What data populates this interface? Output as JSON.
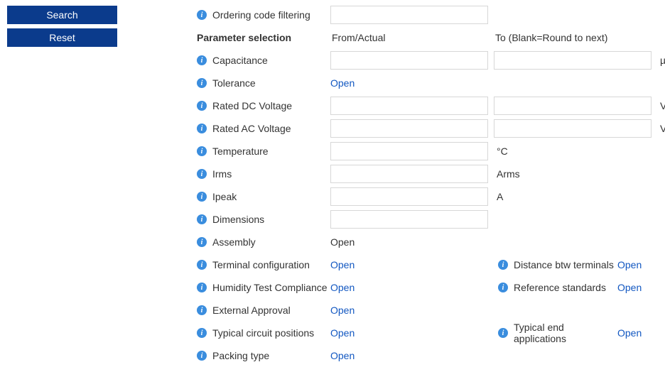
{
  "sidebar": {
    "search_label": "Search",
    "reset_label": "Reset"
  },
  "filter": {
    "ordering_code_label": "Ordering code filtering",
    "ordering_code_value": ""
  },
  "header": {
    "param_selection": "Parameter selection",
    "from_actual": "From/Actual",
    "to_blank": "To (Blank=Round to next)"
  },
  "params": {
    "capacitance": {
      "label": "Capacitance",
      "from": "",
      "to": "",
      "unit": "µF"
    },
    "tolerance": {
      "label": "Tolerance",
      "action": "Open"
    },
    "rated_dc": {
      "label": "Rated DC Voltage",
      "from": "",
      "to": "",
      "unit": "Vdc"
    },
    "rated_ac": {
      "label": "Rated AC Voltage",
      "from": "",
      "to": "",
      "unit": "Vrms"
    },
    "temperature": {
      "label": "Temperature",
      "from": "",
      "unit": "°C"
    },
    "irms": {
      "label": "Irms",
      "from": "",
      "unit": "Arms"
    },
    "ipeak": {
      "label": "Ipeak",
      "from": "",
      "unit": "A"
    },
    "dimensions": {
      "label": "Dimensions",
      "from": ""
    },
    "assembly": {
      "label": "Assembly",
      "action": "Open"
    },
    "terminal_config": {
      "label": "Terminal configuration",
      "action": "Open"
    },
    "distance_terminals": {
      "label": "Distance btw terminals",
      "action": "Open"
    },
    "humidity": {
      "label": "Humidity Test Compliance",
      "action": "Open"
    },
    "reference_standards": {
      "label": "Reference standards",
      "action": "Open"
    },
    "external_approval": {
      "label": "External Approval",
      "action": "Open"
    },
    "typical_circuit": {
      "label": "Typical circuit positions",
      "action": "Open"
    },
    "typical_end": {
      "label": "Typical end applications",
      "action": "Open"
    },
    "packing_type": {
      "label": "Packing type",
      "action": "Open"
    }
  }
}
